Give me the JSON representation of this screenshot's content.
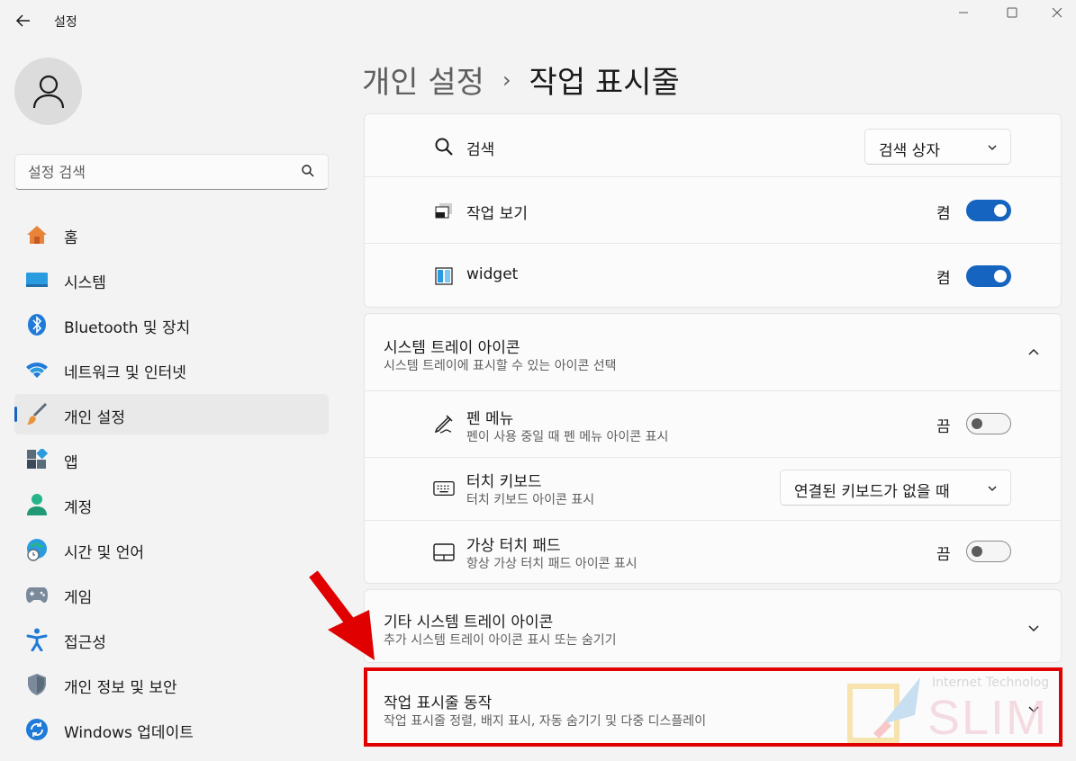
{
  "app": {
    "title": "설정"
  },
  "search": {
    "placeholder": "설정 검색"
  },
  "sidebar": {
    "items": [
      {
        "label": "홈",
        "icon": "home-icon",
        "active": false
      },
      {
        "label": "시스템",
        "icon": "system-icon",
        "active": false
      },
      {
        "label": "Bluetooth 및 장치",
        "icon": "bluetooth-icon",
        "active": false
      },
      {
        "label": "네트워크 및 인터넷",
        "icon": "wifi-icon",
        "active": false
      },
      {
        "label": "개인 설정",
        "icon": "brush-icon",
        "active": true
      },
      {
        "label": "앱",
        "icon": "apps-icon",
        "active": false
      },
      {
        "label": "계정",
        "icon": "account-icon",
        "active": false
      },
      {
        "label": "시간 및 언어",
        "icon": "globe-clock-icon",
        "active": false
      },
      {
        "label": "게임",
        "icon": "gamepad-icon",
        "active": false
      },
      {
        "label": "접근성",
        "icon": "accessibility-icon",
        "active": false
      },
      {
        "label": "개인 정보 및 보안",
        "icon": "shield-icon",
        "active": false
      },
      {
        "label": "Windows 업데이트",
        "icon": "update-icon",
        "active": false
      }
    ]
  },
  "breadcrumb": {
    "parent": "개인 설정",
    "separator": "›",
    "current": "작업 표시줄"
  },
  "taskbar_items": {
    "search": {
      "label": "검색",
      "value": "검색 상자"
    },
    "task_view": {
      "label": "작업 보기",
      "state": "켬",
      "on": true
    },
    "widget": {
      "label": "widget",
      "state": "켬",
      "on": true
    }
  },
  "tray_icons": {
    "title": "시스템 트레이 아이콘",
    "subtitle": "시스템 트레이에 표시할 수 있는 아이콘 선택",
    "pen_menu": {
      "label": "펜 메뉴",
      "sub": "펜이 사용 중일 때 펜 메뉴 아이콘 표시",
      "state": "끔",
      "on": false
    },
    "touch_keyboard": {
      "label": "터치 키보드",
      "sub": "터치 키보드 아이콘 표시",
      "value": "연결된 키보드가 없을 때"
    },
    "virtual_touchpad": {
      "label": "가상 터치 패드",
      "sub": "항상 가상 터치 패드 아이콘 표시",
      "state": "끔",
      "on": false
    }
  },
  "other_tray": {
    "title": "기타 시스템 트레이 아이콘",
    "subtitle": "추가 시스템 트레이 아이콘 표시 또는 숨기기"
  },
  "behaviors": {
    "title": "작업 표시줄 동작",
    "subtitle": "작업 표시줄 정렬, 배지 표시, 자동 숨기기 및 다중 디스플레이"
  },
  "watermark": {
    "line1": "Internet Technolog",
    "line2": "SLIM"
  },
  "colors": {
    "accent": "#1564c0",
    "highlight": "#e00000"
  }
}
